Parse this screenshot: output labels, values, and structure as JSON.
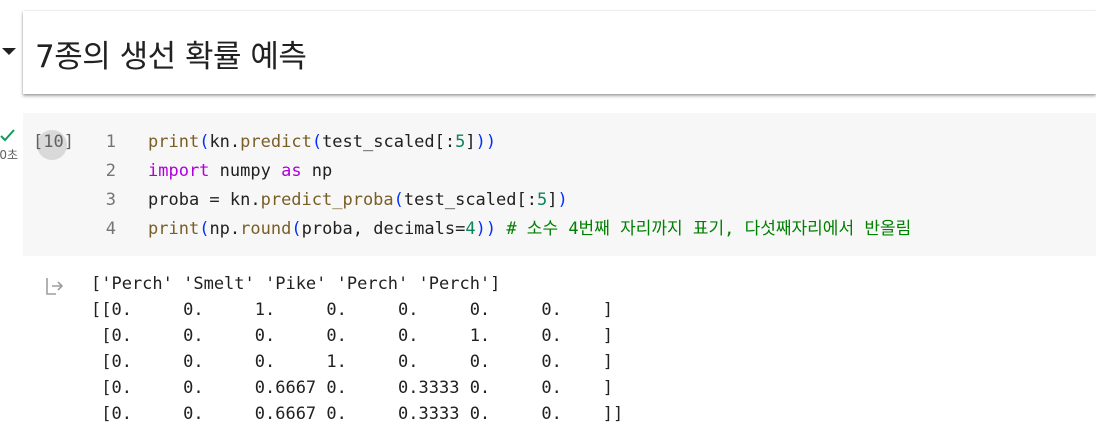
{
  "heading": {
    "title": "7종의 생선 확률 예측"
  },
  "cell_status": {
    "time": "0초"
  },
  "code_cell": {
    "execution_count": "[10]",
    "lines": [
      {
        "number": "1",
        "tokens": [
          {
            "t": "print",
            "c": "kw-fn"
          },
          {
            "t": "(",
            "c": "kw-paren"
          },
          {
            "t": "kn.",
            "c": "plain"
          },
          {
            "t": "predict",
            "c": "kw-fn"
          },
          {
            "t": "(",
            "c": "kw-paren"
          },
          {
            "t": "test_scaled[:",
            "c": "plain"
          },
          {
            "t": "5",
            "c": "kw-num"
          },
          {
            "t": "]",
            "c": "plain"
          },
          {
            "t": "))",
            "c": "kw-paren"
          }
        ]
      },
      {
        "number": "2",
        "tokens": [
          {
            "t": "import",
            "c": "kw-import"
          },
          {
            "t": " numpy ",
            "c": "plain"
          },
          {
            "t": "as",
            "c": "kw-import"
          },
          {
            "t": " np",
            "c": "plain"
          }
        ]
      },
      {
        "number": "3",
        "tokens": [
          {
            "t": "proba = kn.",
            "c": "plain"
          },
          {
            "t": "predict_proba",
            "c": "kw-fn"
          },
          {
            "t": "(",
            "c": "kw-paren"
          },
          {
            "t": "test_scaled[:",
            "c": "plain"
          },
          {
            "t": "5",
            "c": "kw-num"
          },
          {
            "t": "]",
            "c": "plain"
          },
          {
            "t": ")",
            "c": "kw-paren"
          }
        ]
      },
      {
        "number": "4",
        "tokens": [
          {
            "t": "print",
            "c": "kw-fn"
          },
          {
            "t": "(",
            "c": "kw-paren"
          },
          {
            "t": "np.",
            "c": "plain"
          },
          {
            "t": "round",
            "c": "kw-fn"
          },
          {
            "t": "(",
            "c": "kw-paren"
          },
          {
            "t": "proba, decimals=",
            "c": "plain"
          },
          {
            "t": "4",
            "c": "kw-num"
          },
          {
            "t": "))",
            "c": "kw-paren"
          },
          {
            "t": " # 소수 4번째 자리까지 표기, 다섯째자리에서 반올림",
            "c": "kw-comment"
          }
        ]
      }
    ]
  },
  "output": {
    "lines": [
      "['Perch' 'Smelt' 'Pike' 'Perch' 'Perch']",
      "[[0.     0.     1.     0.     0.     0.     0.    ]",
      " [0.     0.     0.     0.     0.     1.     0.    ]",
      " [0.     0.     0.     1.     0.     0.     0.    ]",
      " [0.     0.     0.6667 0.     0.3333 0.     0.    ]",
      " [0.     0.     0.6667 0.     0.3333 0.     0.    ]]"
    ]
  },
  "colors": {
    "check": "#0f9d58",
    "code_bg": "#f7f7f7",
    "comment": "#008000",
    "function": "#795e26",
    "keyword": "#af00db",
    "number": "#098658"
  },
  "icons": {
    "toggle": "triangle-down-icon",
    "status": "checkmark-icon",
    "output": "output-arrow-icon"
  }
}
